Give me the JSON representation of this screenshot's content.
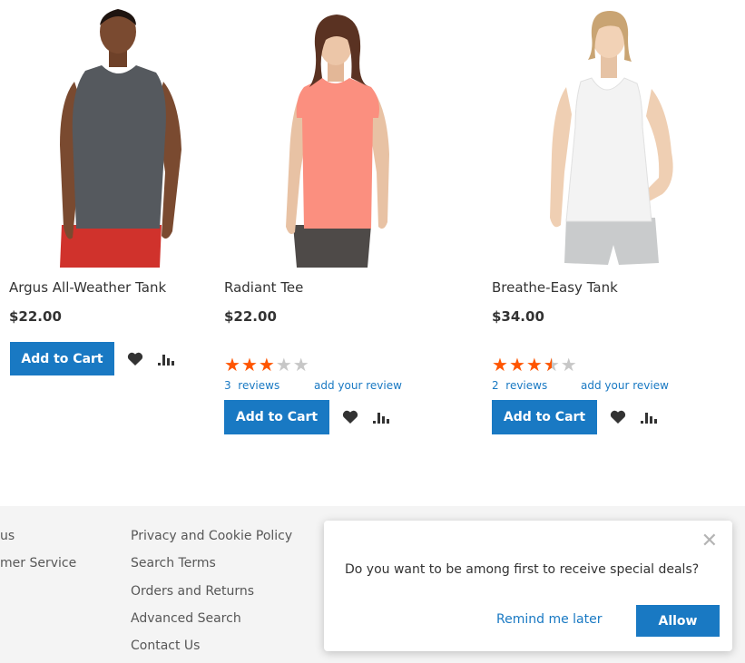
{
  "products": [
    {
      "name": "Argus All-Weather Tank",
      "price": "$22.00",
      "add_to_cart": "Add to Cart",
      "image": "man-grey-sleeveless-tank",
      "wishlist_icon": "heart-icon",
      "compare_icon": "compare-icon"
    },
    {
      "name": "Radiant Tee",
      "price": "$22.00",
      "rating_percent": 60,
      "reviews_count": "3",
      "reviews_label": "reviews",
      "add_review": "add your review",
      "add_to_cart": "Add to Cart",
      "image": "woman-coral-tee",
      "wishlist_icon": "heart-icon",
      "compare_icon": "compare-icon"
    },
    {
      "name": "Breathe-Easy Tank",
      "price": "$34.00",
      "rating_percent": 70,
      "reviews_count": "2",
      "reviews_label": "reviews",
      "add_review": "add your review",
      "add_to_cart": "Add to Cart",
      "image": "woman-white-tank",
      "wishlist_icon": "heart-icon",
      "compare_icon": "compare-icon"
    }
  ],
  "footer": {
    "col1": [
      "us",
      "mer Service"
    ],
    "col2": [
      "Privacy and Cookie Policy",
      "Search Terms",
      "Orders and Returns",
      "Advanced Search",
      "Contact Us"
    ]
  },
  "popup": {
    "message": "Do you want to be among first to receive special deals?",
    "remind": "Remind me later",
    "allow": "Allow",
    "close_icon": "close-icon"
  },
  "colors": {
    "accent": "#1979c3",
    "star": "#ff5501",
    "footer_bg": "#f4f4f4"
  }
}
